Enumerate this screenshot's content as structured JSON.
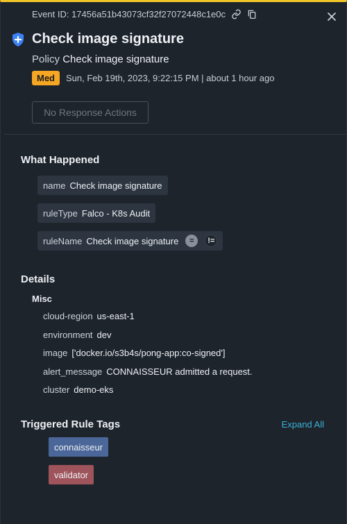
{
  "header": {
    "event_id_text": "Event ID: 17456a51b43073cf32f27072448c1e0c",
    "title": "Check image signature",
    "policy_prefix": "Policy",
    "policy_name": "Check image signature",
    "severity": "Med",
    "timestamp": "Sun, Feb 19th, 2023, 9:22:15 PM | about 1 hour ago",
    "response_button": "No Response Actions"
  },
  "what_happened": {
    "title": "What Happened",
    "items": [
      {
        "key": "name",
        "value": "Check image signature"
      },
      {
        "key": "ruleType",
        "value": "Falco - K8s Audit"
      },
      {
        "key": "ruleName",
        "value": "Check image signature",
        "eq": "=",
        "neq": "!="
      }
    ]
  },
  "details": {
    "title": "Details",
    "group": "Misc",
    "rows": [
      {
        "key": "cloud-region",
        "value": "us-east-1"
      },
      {
        "key": "environment",
        "value": "dev"
      },
      {
        "key": "image",
        "value": "['docker.io/s3b4s/pong-app:co-signed']"
      },
      {
        "key": "alert_message",
        "value": "CONNAISSEUR admitted a request."
      },
      {
        "key": "cluster",
        "value": "demo-eks"
      }
    ]
  },
  "tags": {
    "title": "Triggered Rule Tags",
    "expand_label": "Expand All",
    "items": [
      {
        "label": "connaisseur",
        "color": "#4b6698"
      },
      {
        "label": "validator",
        "color": "#9e545a"
      }
    ]
  },
  "colors": {
    "accent_top": "#f3c628",
    "severity_med": "#f5a623",
    "link": "#3bb1d9",
    "panel_bg": "#1e242c"
  },
  "icons": [
    "link-icon",
    "copy-icon",
    "close-icon",
    "shield-plus-icon"
  ]
}
